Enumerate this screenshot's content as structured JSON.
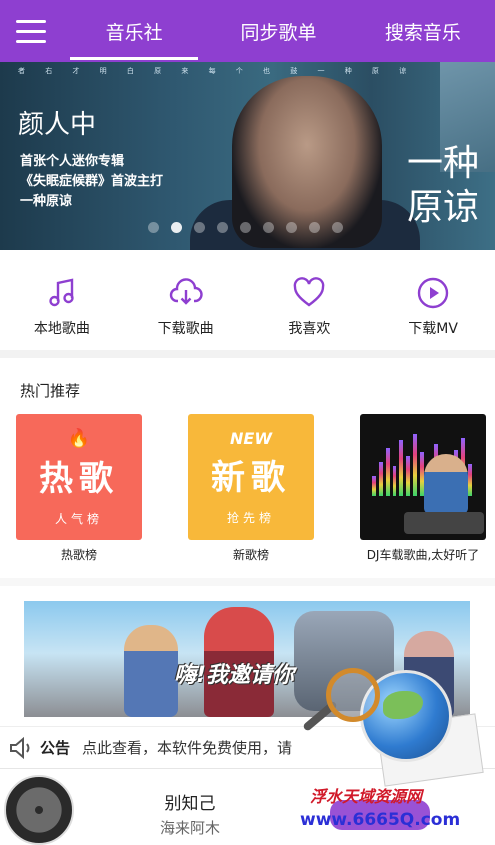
{
  "header": {
    "tabs": [
      {
        "label": "音乐社",
        "active": true
      },
      {
        "label": "同步歌单",
        "active": false
      },
      {
        "label": "搜索音乐",
        "active": false
      }
    ],
    "accent_color": "#8e3fd0"
  },
  "banner": {
    "singer": "颜人中",
    "promo_lines": [
      "首张个人迷你专辑",
      "《失眠症候群》首波主打",
      "一种原谅"
    ],
    "title_art": [
      "一种",
      "原谅"
    ],
    "lyric_strip": "者 右 才 明 白 原 来 每 个 也 鼓 一 种 原 谅",
    "dots_count": 9,
    "active_dot": 1
  },
  "quick_actions": [
    {
      "label": "本地歌曲",
      "icon": "music-note-icon"
    },
    {
      "label": "下载歌曲",
      "icon": "cloud-download-icon"
    },
    {
      "label": "我喜欢",
      "icon": "heart-icon"
    },
    {
      "label": "下载MV",
      "icon": "play-circle-icon"
    }
  ],
  "hot": {
    "title": "热门推荐",
    "cards": [
      {
        "cover_big": "热歌",
        "cover_small": "人气榜",
        "label": "热歌榜",
        "color": "#f7695a"
      },
      {
        "cover_big": "新歌",
        "cover_small": "抢先榜",
        "cover_tag": "NEW",
        "label": "新歌榜",
        "color": "#f8b83a"
      },
      {
        "label": "DJ车载歌曲,太好听了"
      }
    ]
  },
  "ad": {
    "slogan": "嗨!我邀请你"
  },
  "notice": {
    "label": "公告",
    "text": "点此查看，本软件免费使用，请"
  },
  "player": {
    "song": "别知己",
    "artist": "海来阿木"
  },
  "watermark": {
    "text": "浮水天域资源网",
    "url": "www.6665Q.com"
  }
}
